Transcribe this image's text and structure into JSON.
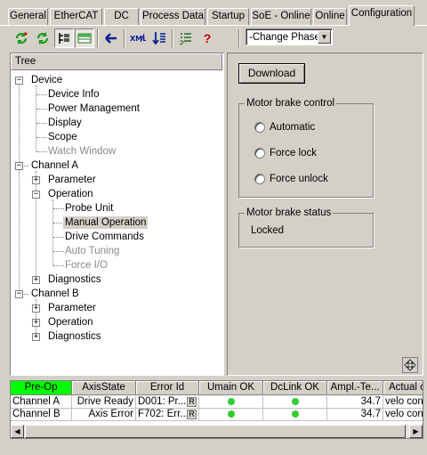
{
  "tabs": [
    "General",
    "EtherCAT",
    "DC",
    "Process Data",
    "Startup",
    "SoE - Online",
    "Online",
    "Configuration"
  ],
  "active_tab": "Configuration",
  "toolbar": {
    "phase_select": "-Change Phase-"
  },
  "tree": {
    "header": "Tree",
    "nodes": {
      "device": "Device",
      "device_info": "Device Info",
      "power_management": "Power Management",
      "display": "Display",
      "scope": "Scope",
      "watch_window": "Watch Window",
      "channel_a": "Channel A",
      "a_parameter": "Parameter",
      "a_operation": "Operation",
      "probe_unit": "Probe Unit",
      "manual_operation": "Manual Operation",
      "drive_commands": "Drive Commands",
      "auto_tuning": "Auto Tuning",
      "force_io": "Force I/O",
      "a_diagnostics": "Diagnostics",
      "channel_b": "Channel B",
      "b_parameter": "Parameter",
      "b_operation": "Operation",
      "b_diagnostics": "Diagnostics"
    }
  },
  "panel": {
    "download_label": "Download",
    "brake_control_title": "Motor brake control",
    "options": [
      "Automatic",
      "Force lock",
      "Force unlock"
    ],
    "brake_status_title": "Motor brake status",
    "brake_status_value": "Locked"
  },
  "grid": {
    "headers": [
      "Pre-Op",
      "AxisState",
      "Error Id",
      "Umain OK",
      "DcLink OK",
      "Ampl.-Te...",
      "Actual o"
    ],
    "rows": [
      {
        "name": "Channel A",
        "state": "Drive Ready",
        "error": "D001: Pr...",
        "r": "R",
        "temp": "34.7",
        "actual": "velo con"
      },
      {
        "name": "Channel B",
        "state": "Axis Error",
        "error": "F702: Err...",
        "r": "R",
        "temp": "34.7",
        "actual": "velo con"
      }
    ]
  },
  "colors": {
    "preop": "#00ff00",
    "ok_led": "#33cc33",
    "refresh_icon": "#1a9b1a"
  }
}
